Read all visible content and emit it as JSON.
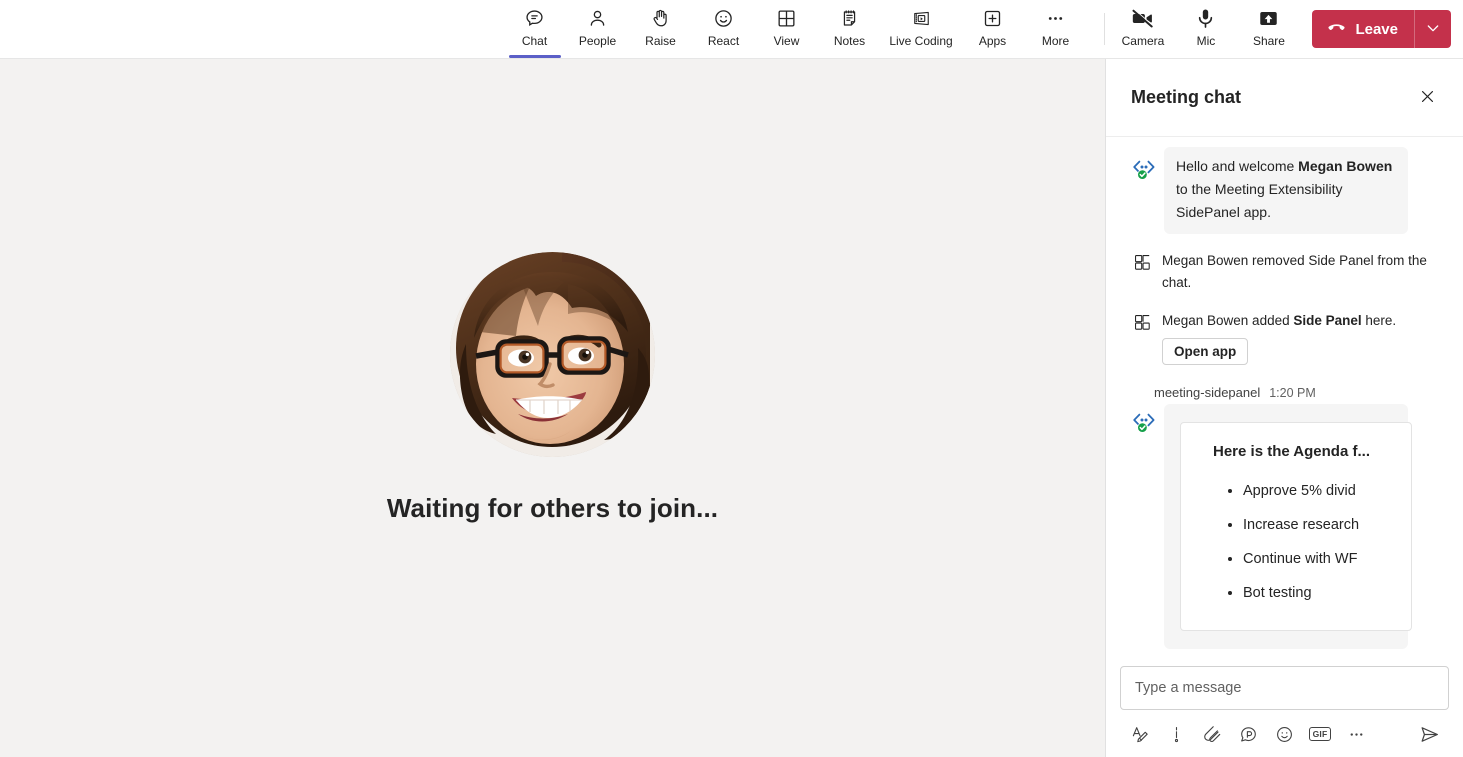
{
  "toolbar": {
    "items": [
      {
        "label": "Chat",
        "icon": "chat-icon",
        "active": true
      },
      {
        "label": "People",
        "icon": "people-icon",
        "active": false
      },
      {
        "label": "Raise",
        "icon": "raise-hand-icon",
        "active": false
      },
      {
        "label": "React",
        "icon": "react-smiley-icon",
        "active": false
      },
      {
        "label": "View",
        "icon": "view-grid-icon",
        "active": false
      },
      {
        "label": "Notes",
        "icon": "notes-icon",
        "active": false
      },
      {
        "label": "Live Coding",
        "icon": "live-coding-icon",
        "active": false
      },
      {
        "label": "Apps",
        "icon": "apps-plus-icon",
        "active": false
      },
      {
        "label": "More",
        "icon": "more-ellipsis-icon",
        "active": false
      }
    ],
    "device_controls": [
      {
        "label": "Camera",
        "icon": "camera-off-icon"
      },
      {
        "label": "Mic",
        "icon": "microphone-icon"
      },
      {
        "label": "Share",
        "icon": "share-arrow-up-icon"
      }
    ],
    "leave_label": "Leave",
    "leave_color": "#c4314b",
    "active_indicator_color": "#5b5fc7"
  },
  "stage": {
    "waiting_text": "Waiting for others to join...",
    "avatar_alt": "participant-photo",
    "background_color": "#f3f2f1"
  },
  "chat": {
    "title": "Meeting chat",
    "close_icon": "close-icon",
    "messages": [
      {
        "type": "bot-bubble",
        "avatar_icon": "bot-code-icon",
        "verified_badge": true,
        "text_parts": [
          {
            "text": "Hello and welcome ",
            "bold": false
          },
          {
            "text": "Megan Bowen",
            "bold": true
          },
          {
            "text": " to the Meeting Extensibility SidePanel app.",
            "bold": false
          }
        ]
      },
      {
        "type": "system",
        "icon": "app-square-icon",
        "text_parts": [
          {
            "text": "Megan Bowen removed Side Panel from the chat.",
            "bold": false
          }
        ]
      },
      {
        "type": "system",
        "icon": "app-square-icon",
        "text_parts": [
          {
            "text": "Megan Bowen added ",
            "bold": false
          },
          {
            "text": "Side Panel",
            "bold": true
          },
          {
            "text": " here.",
            "bold": false
          }
        ],
        "button_label": "Open app"
      },
      {
        "type": "card",
        "sender": "meeting-sidepanel",
        "time": "1:20 PM",
        "avatar_icon": "bot-code-icon",
        "verified_badge": true,
        "card": {
          "title": "Here is the Agenda f...",
          "items": [
            "Approve 5% divid",
            "Increase research",
            "Continue with WF",
            "Bot testing"
          ]
        }
      }
    ],
    "compose": {
      "placeholder": "Type a message",
      "value": "",
      "tools": [
        {
          "name": "format-text-icon",
          "label": "Format"
        },
        {
          "name": "importance-icon",
          "label": "Set delivery options"
        },
        {
          "name": "attach-paperclip-icon",
          "label": "Attach"
        },
        {
          "name": "loop-component-icon",
          "label": "Loop component"
        },
        {
          "name": "emoji-icon",
          "label": "Emoji"
        },
        {
          "name": "gif-icon",
          "label": "GIF"
        },
        {
          "name": "more-options-icon",
          "label": "More options"
        }
      ],
      "send_icon": "send-paper-plane-icon"
    }
  }
}
